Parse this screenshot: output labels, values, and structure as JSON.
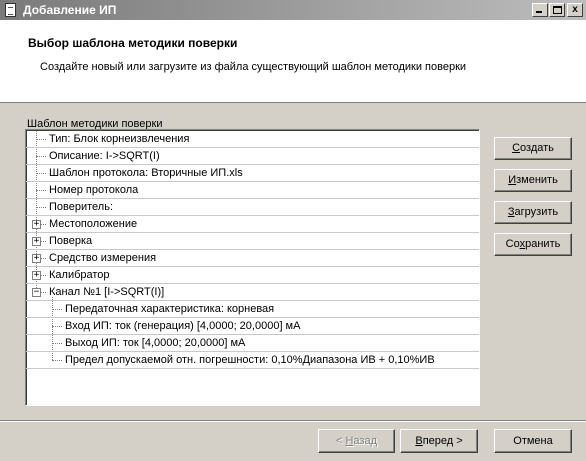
{
  "window": {
    "title": "Добавление ИП",
    "min_glyph": "_",
    "max_glyph": "□",
    "close_glyph": "x"
  },
  "header": {
    "title": "Выбор шаблона методики поверки",
    "subtitle": "Создайте новый или загрузите из файла существующий шаблон методики поверки"
  },
  "group_label": "Шаблон методики поверки",
  "tree": {
    "items": [
      {
        "label": "Тип: Блок корнеизвлечения",
        "level": 0,
        "expander": ""
      },
      {
        "label": "Описание: I->SQRT(I)",
        "level": 0,
        "expander": ""
      },
      {
        "label": "Шаблон протокола: Вторичные ИП.xls",
        "level": 0,
        "expander": ""
      },
      {
        "label": "Номер протокола",
        "level": 0,
        "expander": ""
      },
      {
        "label": "Поверитель:",
        "level": 0,
        "expander": ""
      },
      {
        "label": "Местоположение",
        "level": 0,
        "expander": "+"
      },
      {
        "label": "Поверка",
        "level": 0,
        "expander": "+"
      },
      {
        "label": "Средство измерения",
        "level": 0,
        "expander": "+"
      },
      {
        "label": "Калибратор",
        "level": 0,
        "expander": "+"
      },
      {
        "label": "Канал №1 [I->SQRT(I)]",
        "level": 0,
        "expander": "−"
      },
      {
        "label": "Передаточная характеристика: корневая",
        "level": 1,
        "expander": ""
      },
      {
        "label": "Вход ИП: ток (генерация) [4,0000; 20,0000] мА",
        "level": 1,
        "expander": ""
      },
      {
        "label": "Выход ИП: ток [4,0000; 20,0000] мА",
        "level": 1,
        "expander": ""
      },
      {
        "label": "Предел допускаемой отн. погрешности: 0,10%Диапазона ИВ + 0,10%ИВ",
        "level": 1,
        "expander": ""
      }
    ]
  },
  "side_buttons": {
    "create": {
      "u": "С",
      "rest": "оздать"
    },
    "edit": {
      "u": "И",
      "rest": "зменить"
    },
    "load": {
      "u": "З",
      "rest": "агрузить"
    },
    "save_pre": "Со",
    "save_u": "х",
    "save_rest": "ранить"
  },
  "bottom_buttons": {
    "back_pre": "< ",
    "back_u": "Н",
    "back_rest": "азад",
    "next_u": "В",
    "next_rest": "перед >",
    "cancel": "Отмена"
  }
}
